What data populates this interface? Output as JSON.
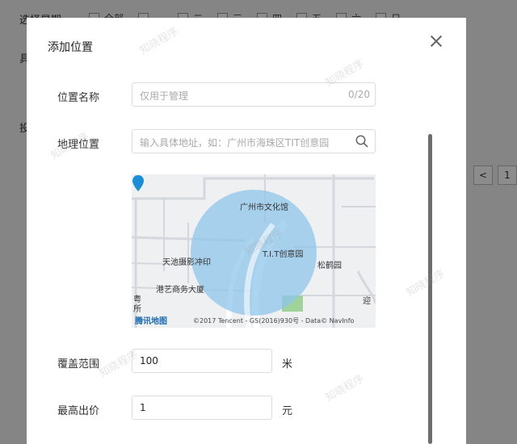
{
  "background": {
    "row1_label": "选择星期",
    "days": [
      "全部",
      "一",
      "二",
      "三",
      "四",
      "五",
      "六",
      "日"
    ],
    "row2_label": "具",
    "row3_label": "投",
    "pager_prev": "<",
    "pager_page": "1"
  },
  "dialog": {
    "title": "添加位置",
    "name_label": "位置名称",
    "name_placeholder": "仅用于管理",
    "name_counter": "0/20",
    "geo_label": "地理位置",
    "geo_placeholder": "输入具体地址，如：广州市海珠区TIT创意园",
    "map": {
      "labels": {
        "museum": "广州市文化馆",
        "creative_park": "T.I.T创意园",
        "photo": "天池摄影冲印",
        "songhe": "松鹤园",
        "gangyi": "港艺商务大厦",
        "left_partial1": "粤",
        "left_partial2": "所",
        "right_partial": "迎"
      },
      "logo_text": "腾讯地图",
      "copyright": "©2017 Tencent - GS(2016)930号 - Data© NavInfo"
    },
    "coverage_label": "覆盖范围",
    "coverage_value": "100",
    "coverage_unit": "米",
    "bid_label": "最高出价",
    "bid_value": "1",
    "bid_unit": "元"
  },
  "watermark": "知晓程序",
  "colors": {
    "circle": "#8ec5ea",
    "pin": "#1a8fd8"
  }
}
